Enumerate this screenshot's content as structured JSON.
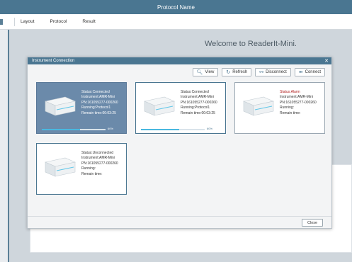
{
  "window": {
    "title": "Protocol Name"
  },
  "menu": {
    "items": [
      "Layout",
      "Protocol",
      "Result"
    ]
  },
  "main": {
    "welcome": "Welcome to ReaderIt-Mini."
  },
  "dialog": {
    "title": "Instrument Connection",
    "close_label": "Close",
    "toolbar": {
      "view_label": "View",
      "refresh_label": "Refresh",
      "disconnect_label": "Disconnect",
      "connect_label": "Connect"
    },
    "instruments": [
      {
        "status": "Status:Connected",
        "instrument": "Instrument:AMR-Mini",
        "pn": "PN:161055277-000260",
        "running": "Running:Protocol1",
        "remain": "Remain time:00:03:25",
        "progress_percent": 60,
        "progress_label": "60%",
        "selected": true
      },
      {
        "status": "Status:Connected",
        "instrument": "Instrument:AMR-Mini",
        "pn": "PN:161055277-000260",
        "running": "Running:Protocol1",
        "remain": "Remain time:00:03:25",
        "progress_percent": 60,
        "progress_label": "60%",
        "selected": false
      },
      {
        "status": "Status:Alarm",
        "instrument": "Instrument:AMR-Mini",
        "pn": "PN:161055277-000260",
        "running": "Running:",
        "remain": "Remain time:",
        "selected": false
      },
      {
        "status": "Status:Unconnected",
        "instrument": "Instrument:AMR-Mini",
        "pn": "PN:161055277-000260",
        "running": "Running:",
        "remain": "Remain time:",
        "selected": false
      }
    ]
  },
  "colors": {
    "accent": "#4a7691",
    "selected_card": "#6b8aaa",
    "alarm": "#b01c1c",
    "progress": "#4ab8e0"
  }
}
